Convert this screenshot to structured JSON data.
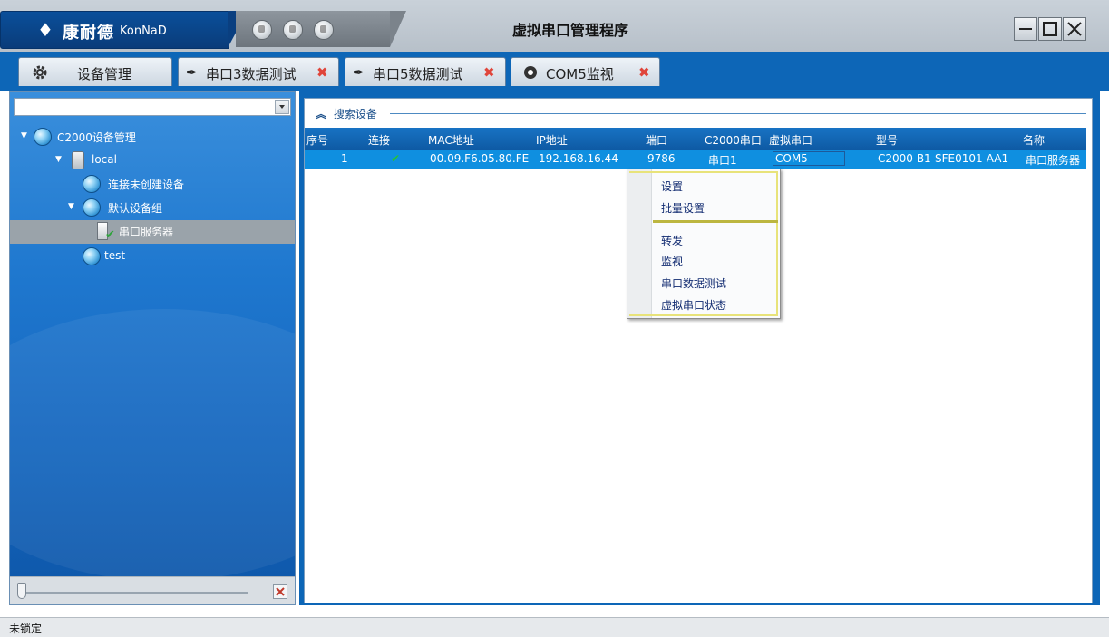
{
  "window": {
    "brand_cn": "康耐德",
    "brand_en": "KonNaD",
    "title": "虚拟串口管理程序"
  },
  "tabs": [
    {
      "label": "设备管理",
      "icon": "gear-icon",
      "closable": false
    },
    {
      "label": "串口3数据测试",
      "icon": "plug-icon",
      "closable": true
    },
    {
      "label": "串口5数据测试",
      "icon": "plug-icon",
      "closable": true
    },
    {
      "label": "COM5监视",
      "icon": "monitor-icon",
      "closable": true
    }
  ],
  "tree": {
    "combo_value": "",
    "items": [
      {
        "label": "C2000设备管理"
      },
      {
        "label": "local"
      },
      {
        "label": "连接未创建设备"
      },
      {
        "label": "默认设备组"
      },
      {
        "label": "串口服务器"
      },
      {
        "label": "test"
      }
    ]
  },
  "search": {
    "group_title": "搜索设备",
    "columns": [
      "序号",
      "连接",
      "MAC地址",
      "IP地址",
      "端口",
      "C2000串口",
      "虚拟串口",
      "型号",
      "名称"
    ],
    "rows": [
      {
        "index": "1",
        "connected": "✔",
        "mac": "00.09.F6.05.80.FE",
        "ip": "192.168.16.44",
        "port": "9786",
        "c2000_port": "串口1",
        "virtual_port": "COM5",
        "model": "C2000-B1-SFE0101-AA1",
        "name": "串口服务器"
      }
    ]
  },
  "context_menu": {
    "items": [
      "设置",
      "批量设置",
      "转发",
      "监视",
      "串口数据测试",
      "虚拟串口状态"
    ]
  },
  "status": {
    "text": "未锁定"
  },
  "colors": {
    "accent": "#0d66b7",
    "row_selected": "#0f8fe0",
    "close_red": "#e0453a"
  }
}
